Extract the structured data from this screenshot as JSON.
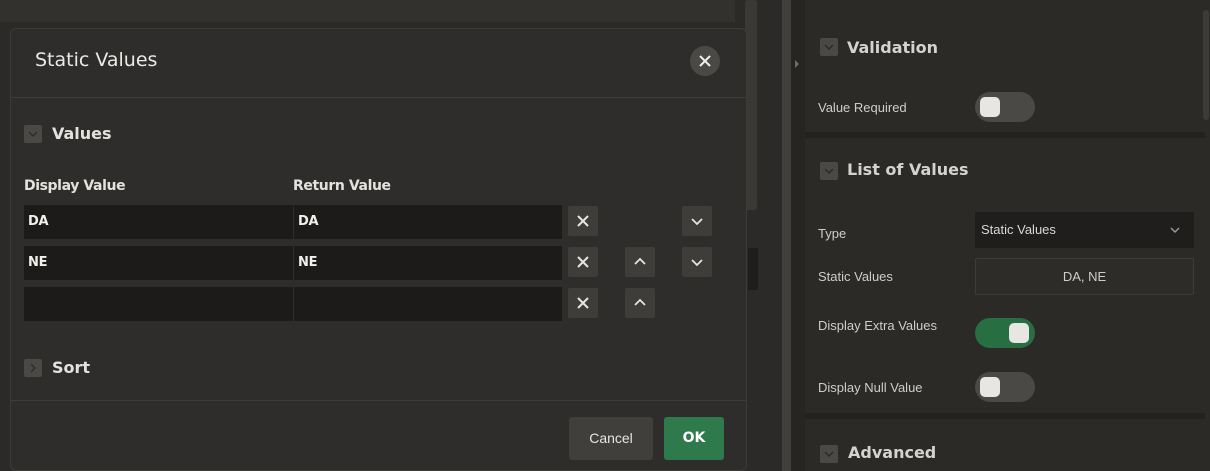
{
  "dialog": {
    "title": "Static Values",
    "close_icon": "close-icon",
    "values_section": {
      "title": "Values",
      "columns": {
        "display": "Display Value",
        "return": "Return Value"
      },
      "rows": [
        {
          "display": "DA",
          "return": "DA"
        },
        {
          "display": "NE",
          "return": "NE"
        },
        {
          "display": "",
          "return": ""
        }
      ]
    },
    "sort_section": {
      "title": "Sort"
    },
    "cancel_label": "Cancel",
    "ok_label": "OK"
  },
  "properties": {
    "validation": {
      "title": "Validation",
      "value_required_label": "Value Required",
      "value_required": false
    },
    "list_of_values": {
      "title": "List of Values",
      "type_label": "Type",
      "type_value": "Static Values",
      "static_values_label": "Static Values",
      "static_values_value": "DA, NE",
      "display_extra_values_label": "Display Extra Values",
      "display_extra_values": true,
      "display_null_value_label": "Display Null Value",
      "display_null_value": false
    },
    "advanced": {
      "title": "Advanced"
    }
  },
  "colors": {
    "accent_green": "#2e7a4c",
    "toggle_on": "#276e43",
    "background": "#2b2a27"
  }
}
